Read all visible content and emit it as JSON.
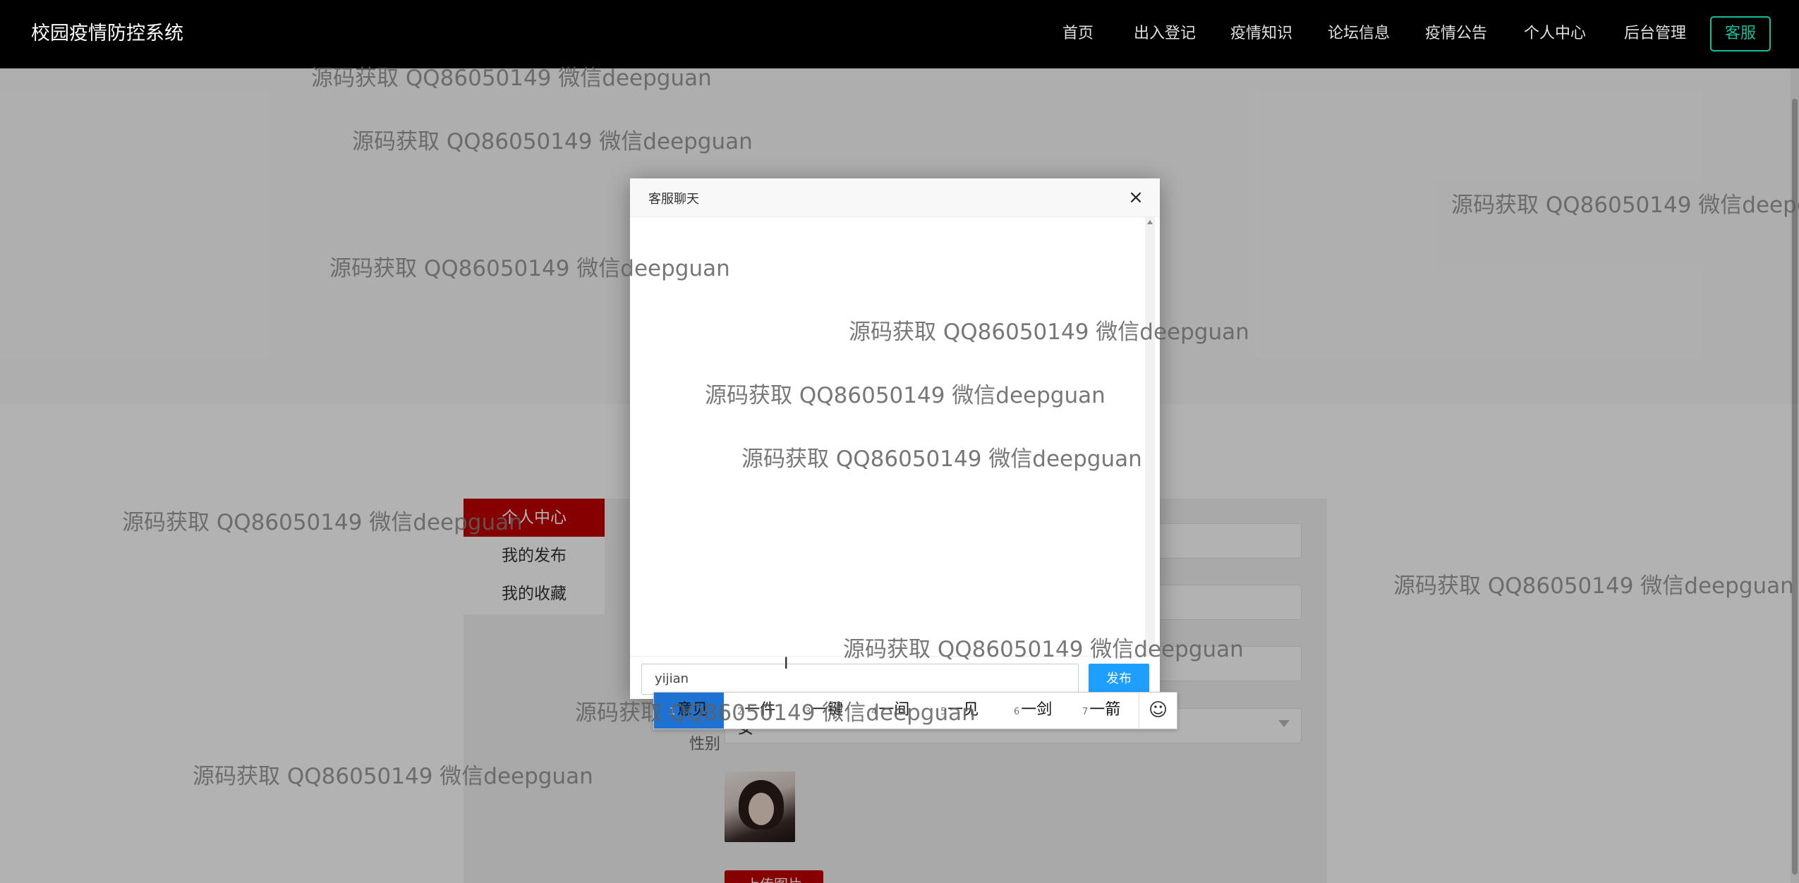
{
  "navbar": {
    "brand": "校园疫情防控系统",
    "links": [
      "首页",
      "出入登记",
      "疫情知识",
      "论坛信息",
      "疫情公告",
      "个人中心",
      "后台管理"
    ],
    "service_button": "客服"
  },
  "side_menu": {
    "title": "个人中心",
    "items": [
      "我的发布",
      "我的收藏"
    ]
  },
  "form": {
    "select_value": "女",
    "select_label": "性别",
    "upload_button": "上传图片"
  },
  "chat": {
    "title": "客服聊天",
    "close_symbol": "×",
    "input_value": "yijian",
    "send_label": "发布"
  },
  "ime": {
    "candidates": [
      {
        "num": "1",
        "text": "意见"
      },
      {
        "num": "2",
        "text": "一件"
      },
      {
        "num": "3",
        "text": "一键"
      },
      {
        "num": "4",
        "text": "一间"
      },
      {
        "num": "5",
        "text": "一见"
      },
      {
        "num": "6",
        "text": "一剑"
      },
      {
        "num": "7",
        "text": "一箭"
      }
    ],
    "emoji_icon": "☺"
  },
  "watermark_text": "源码获取 QQ86050149 微信deepguan",
  "colors": {
    "navbar_bg": "#000000",
    "accent_red": "#c00000",
    "service_teal": "#1abc9c",
    "send_blue": "#1e9fff",
    "ime_highlight": "#1e73d2"
  }
}
